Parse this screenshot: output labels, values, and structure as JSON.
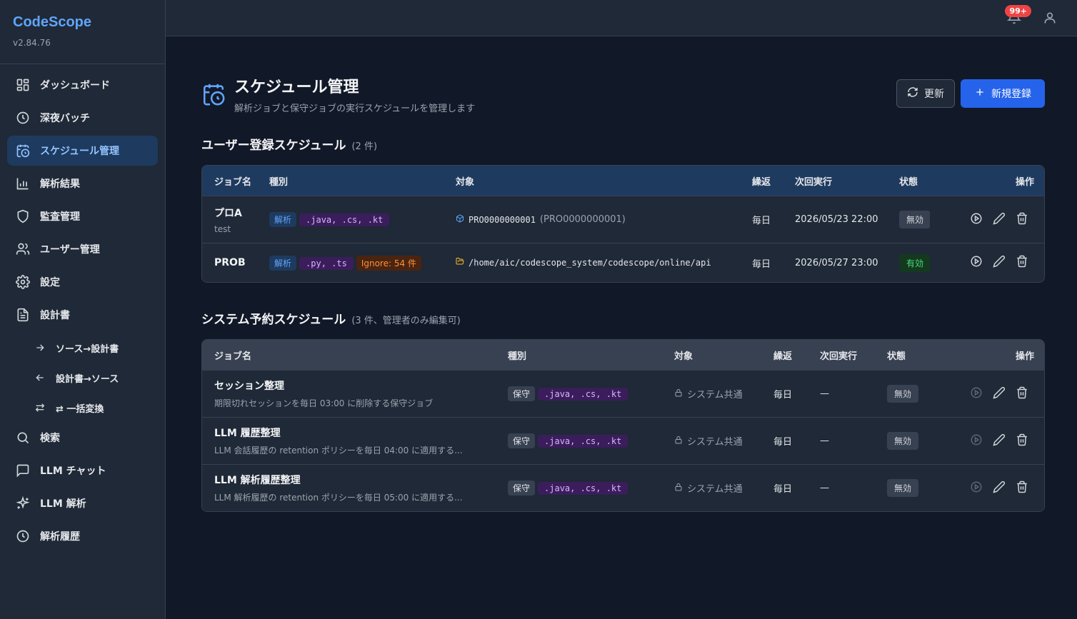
{
  "app": {
    "name": "CodeScope",
    "version": "v2.84.76"
  },
  "sidebar": {
    "items": [
      {
        "label": "ダッシュボード"
      },
      {
        "label": "深夜バッチ"
      },
      {
        "label": "スケジュール管理"
      },
      {
        "label": "解析結果"
      },
      {
        "label": "監査管理"
      },
      {
        "label": "ユーザー管理"
      },
      {
        "label": "設定"
      },
      {
        "label": "設計書"
      }
    ],
    "sub_items": [
      {
        "label": "ソース→設計書"
      },
      {
        "label": "設計書→ソース"
      },
      {
        "label": "⇄ 一括変換"
      }
    ],
    "bottom_items": [
      {
        "label": "検索"
      },
      {
        "label": "LLM チャット"
      },
      {
        "label": "LLM 解析"
      },
      {
        "label": "解析履歴"
      }
    ]
  },
  "topbar": {
    "notification_count": "99+"
  },
  "page": {
    "title": "スケジュール管理",
    "subtitle": "解析ジョブと保守ジョブの実行スケジュールを管理します",
    "refresh_label": "更新",
    "new_label": "新規登録"
  },
  "user_schedules": {
    "title": "ユーザー登録スケジュール",
    "count": "(2 件)",
    "headers": {
      "name": "ジョブ名",
      "kind": "種別",
      "target": "対象",
      "repeat": "繰返",
      "next": "次回実行",
      "status": "状態",
      "ops": "操作"
    },
    "rows": [
      {
        "name": "プロA",
        "desc": "test",
        "kind": "解析",
        "ext": ".java, .cs, .kt",
        "ignore": "",
        "target_code": "PRO0000000001",
        "target_paren": "(PRO0000000001)",
        "repeat": "毎日",
        "next": "2026/05/23 22:00",
        "status": "無効"
      },
      {
        "name": "PROB",
        "desc": "",
        "kind": "解析",
        "ext": ".py, .ts",
        "ignore": "Ignore: 54 件",
        "target_code": "/home/aic/codescope_system/codescope/online/api",
        "target_paren": "",
        "repeat": "毎日",
        "next": "2026/05/27 23:00",
        "status": "有効"
      }
    ]
  },
  "system_schedules": {
    "title": "システム予約スケジュール",
    "count": "(3 件、管理者のみ編集可)",
    "headers": {
      "name": "ジョブ名",
      "kind": "種別",
      "target": "対象",
      "repeat": "繰返",
      "next": "次回実行",
      "status": "状態",
      "ops": "操作"
    },
    "rows": [
      {
        "name": "セッション整理",
        "desc": "期限切れセッションを毎日 03:00 に削除する保守ジョブ",
        "kind": "保守",
        "ext": ".java, .cs, .kt",
        "target": "システム共通",
        "repeat": "毎日",
        "next": "—",
        "status": "無効"
      },
      {
        "name": "LLM 履歴整理",
        "desc": "LLM 会話履歴の retention ポリシーを毎日 04:00 に適用する...",
        "kind": "保守",
        "ext": ".java, .cs, .kt",
        "target": "システム共通",
        "repeat": "毎日",
        "next": "—",
        "status": "無効"
      },
      {
        "name": "LLM 解析履歴整理",
        "desc": "LLM 解析履歴の retention ポリシーを毎日 05:00 に適用する...",
        "kind": "保守",
        "ext": ".java, .cs, .kt",
        "target": "システム共通",
        "repeat": "毎日",
        "next": "—",
        "status": "無効"
      }
    ]
  },
  "colors": {
    "accent": "#2563eb",
    "brand": "#60a5fa",
    "ext_tag": "#d8b4fe",
    "active_status": "#4ade80"
  }
}
